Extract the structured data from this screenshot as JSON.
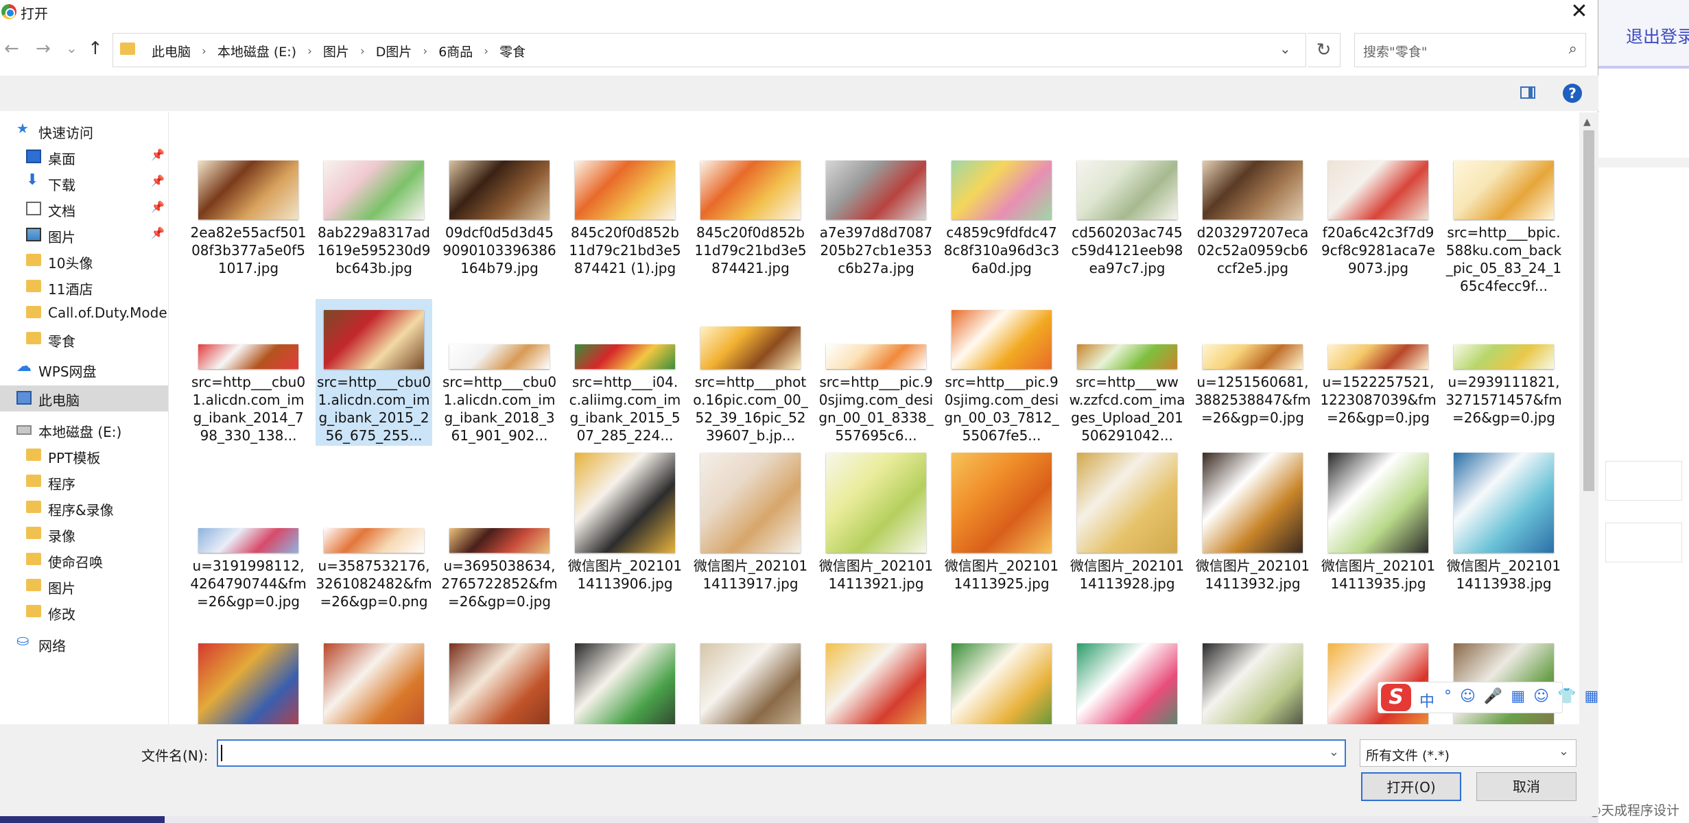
{
  "dialog": {
    "title": "打开",
    "close_glyph": "✕"
  },
  "nav": {
    "back": "←",
    "forward": "→",
    "recent": "⌄",
    "up": "↑",
    "refresh": "↻"
  },
  "breadcrumbs": [
    "此电脑",
    "本地磁盘 (E:)",
    "图片",
    "D图片",
    "6商品",
    "零食"
  ],
  "search": {
    "placeholder": "搜索\"零食\"",
    "icon": "search-icon"
  },
  "toolbar": {
    "help": "?"
  },
  "sidebar": {
    "items": [
      {
        "label": "快速访问",
        "icon": "star-icon",
        "pinned": false,
        "indent": 1
      },
      {
        "label": "桌面",
        "icon": "desktop-icon",
        "pinned": true,
        "indent": 2
      },
      {
        "label": "下载",
        "icon": "download-icon",
        "pinned": true,
        "indent": 2
      },
      {
        "label": "文档",
        "icon": "document-icon",
        "pinned": true,
        "indent": 2
      },
      {
        "label": "图片",
        "icon": "pictures-icon",
        "pinned": true,
        "indent": 2
      },
      {
        "label": "10头像",
        "icon": "folder-icon",
        "pinned": false,
        "indent": 2
      },
      {
        "label": "11酒店",
        "icon": "folder-icon",
        "pinned": false,
        "indent": 2
      },
      {
        "label": "Call.of.Duty.Mode",
        "icon": "folder-icon",
        "pinned": false,
        "indent": 2
      },
      {
        "label": "零食",
        "icon": "folder-icon",
        "pinned": false,
        "indent": 2
      },
      {
        "label": "WPS网盘",
        "icon": "cloud-icon",
        "pinned": false,
        "indent": 1
      },
      {
        "label": "此电脑",
        "icon": "computer-icon",
        "pinned": false,
        "indent": 1,
        "selected": true
      },
      {
        "label": "本地磁盘 (E:)",
        "icon": "disk-icon",
        "pinned": false,
        "indent": 1
      },
      {
        "label": "PPT模板",
        "icon": "folder-icon",
        "pinned": false,
        "indent": 2
      },
      {
        "label": "程序",
        "icon": "folder-icon",
        "pinned": false,
        "indent": 2
      },
      {
        "label": "程序&录像",
        "icon": "folder-icon",
        "pinned": false,
        "indent": 2
      },
      {
        "label": "录像",
        "icon": "folder-icon",
        "pinned": false,
        "indent": 2
      },
      {
        "label": "使命召唤",
        "icon": "folder-icon",
        "pinned": false,
        "indent": 2
      },
      {
        "label": "图片",
        "icon": "folder-icon",
        "pinned": false,
        "indent": 2
      },
      {
        "label": "修改",
        "icon": "folder-icon",
        "pinned": false,
        "indent": 2
      },
      {
        "label": "网络",
        "icon": "network-icon",
        "pinned": false,
        "indent": 1
      }
    ]
  },
  "files": [
    {
      "name": "2ea82e55acf50108f3b377a5e0f51017.jpg",
      "colors": [
        "#7a3b1c",
        "#d9a35e",
        "#f1e3c8"
      ],
      "aspect": "wide"
    },
    {
      "name": "8ab229a8317ad1619e595230d9bc643b.jpg",
      "colors": [
        "#f0c9d0",
        "#7cc26a",
        "#f7f3ef"
      ],
      "aspect": "wide"
    },
    {
      "name": "09dcf0d5d3d459090103396386164b79.jpg",
      "colors": [
        "#3a2214",
        "#8b5a32",
        "#d9c2a0"
      ],
      "aspect": "wide"
    },
    {
      "name": "845c20f0d852b11d79c21bd3e5874421 (1).jpg",
      "colors": [
        "#e86a2a",
        "#f2c14e",
        "#fbf3e8"
      ],
      "aspect": "wide"
    },
    {
      "name": "845c20f0d852b11d79c21bd3e5874421.jpg",
      "colors": [
        "#e86a2a",
        "#f2c14e",
        "#fbf3e8"
      ],
      "aspect": "wide"
    },
    {
      "name": "a7e397d8d7087205b27cb1e353c6b27a.jpg",
      "colors": [
        "#9a9a9a",
        "#b8433f",
        "#d6d6d6"
      ],
      "aspect": "wide"
    },
    {
      "name": "c4859c9fdfdc478c8f310a96d3c36a0d.jpg",
      "colors": [
        "#f4d65a",
        "#e78fb3",
        "#9fd6a6"
      ],
      "aspect": "wide"
    },
    {
      "name": "cd560203ac745c59d4121eeb98ea97c7.jpg",
      "colors": [
        "#dfe6d2",
        "#a6b98f",
        "#f6f4ee"
      ],
      "aspect": "wide"
    },
    {
      "name": "d203297207eca02c52a0959cb6ccf2e5.jpg",
      "colors": [
        "#5a3a24",
        "#a57a52",
        "#e2cfb4"
      ],
      "aspect": "wide"
    },
    {
      "name": "f20a6c42c3f7d99cf8c9281aca7e9073.jpg",
      "colors": [
        "#f5f1ec",
        "#d8453a",
        "#efe3d6"
      ],
      "aspect": "wide"
    },
    {
      "name": "src=http___bpic.588ku.com_back_pic_05_83_24_165c4fecc9f...",
      "colors": [
        "#f7e6b6",
        "#e6a53a",
        "#fff6da"
      ],
      "aspect": "wide"
    },
    {
      "name": "src=http___cbu01.alicdn.com_img_ibank_2014_798_330_138...",
      "colors": [
        "#f6f6f6",
        "#b3541e",
        "#e33d3d"
      ],
      "aspect": "banner"
    },
    {
      "name": "src=http___cbu01.alicdn.com_img_ibank_2015_256_675_255...",
      "colors": [
        "#c3272b",
        "#f2d9a5",
        "#7a4b2a"
      ],
      "aspect": "wide",
      "selected": true
    },
    {
      "name": "src=http___cbu01.alicdn.com_img_ibank_2018_361_901_902...",
      "colors": [
        "#f1f1f1",
        "#d89b55",
        "#ffffff"
      ],
      "aspect": "banner"
    },
    {
      "name": "src=http___i04.c.aliimg.com_img_ibank_2015_507_285_224...",
      "colors": [
        "#d6272a",
        "#f3c743",
        "#3a8e3a"
      ],
      "aspect": "banner"
    },
    {
      "name": "src=http___photo.16pic.com_00_52_39_16pic_5239607_b.jp...",
      "colors": [
        "#f2b233",
        "#8c4c1f",
        "#fff1c7"
      ],
      "aspect": "mid"
    },
    {
      "name": "src=http___pic.90sjimg.com_design_00_01_8338_557695c6...",
      "colors": [
        "#fbe2b8",
        "#f08a3c",
        "#ffffff"
      ],
      "aspect": "banner"
    },
    {
      "name": "src=http___pic.90sjimg.com_design_00_03_7812_55067fe5...",
      "colors": [
        "#fffaf0",
        "#f2a922",
        "#e86b2a"
      ],
      "aspect": "wide"
    },
    {
      "name": "src=http___www.zzfcd.com_images_Upload_201506291042...",
      "colors": [
        "#e7f3d6",
        "#7fbf3f",
        "#c9842c"
      ],
      "aspect": "banner"
    },
    {
      "name": "u=1251560681,3882538847&fm=26&gp=0.jpg",
      "colors": [
        "#f7d37a",
        "#c1702a",
        "#fff4d1"
      ],
      "aspect": "banner"
    },
    {
      "name": "u=1522257521,1223087039&fm=26&gp=0.jpg",
      "colors": [
        "#f5c96a",
        "#b7472a",
        "#fff3d1"
      ],
      "aspect": "banner"
    },
    {
      "name": "u=2939111821,3271571457&fm=26&gp=0.jpg",
      "colors": [
        "#b7d66a",
        "#e9c84a",
        "#f6f9e8"
      ],
      "aspect": "banner"
    },
    {
      "name": "u=3191998112,4264790744&fm=26&gp=0.jpg",
      "colors": [
        "#e8edf7",
        "#d84a6a",
        "#8fb3e0"
      ],
      "aspect": "banner"
    },
    {
      "name": "u=3587532176,3261082482&fm=26&gp=0.png",
      "colors": [
        "#e3763a",
        "#f6d9b5",
        "#ffffff"
      ],
      "aspect": "banner"
    },
    {
      "name": "u=3695038634,2765722852&fm=26&gp=0.jpg",
      "colors": [
        "#4a1f1a",
        "#c74b3a",
        "#eac17a"
      ],
      "aspect": "banner"
    },
    {
      "name": "微信图片_20210114113906.jpg",
      "colors": [
        "#f6f1ea",
        "#2d2d2d",
        "#e7b23c"
      ],
      "aspect": "square"
    },
    {
      "name": "微信图片_20210114113917.jpg",
      "colors": [
        "#e9d9c8",
        "#d7a66a",
        "#f4efe8"
      ],
      "aspect": "square"
    },
    {
      "name": "微信图片_20210114113921.jpg",
      "colors": [
        "#e9ec9a",
        "#b5cf5e",
        "#f7f7ea"
      ],
      "aspect": "square"
    },
    {
      "name": "微信图片_20210114113925.jpg",
      "colors": [
        "#f08e2a",
        "#d95f1a",
        "#f7c25a"
      ],
      "aspect": "square"
    },
    {
      "name": "微信图片_20210114113928.jpg",
      "colors": [
        "#f5f0e6",
        "#e6c26a",
        "#d2a94c"
      ],
      "aspect": "square"
    },
    {
      "name": "微信图片_20210114113932.jpg",
      "colors": [
        "#ffffff",
        "#c9852a",
        "#3a2a20"
      ],
      "aspect": "square"
    },
    {
      "name": "微信图片_20210114113935.jpg",
      "colors": [
        "#ffffff",
        "#b9d98a",
        "#2b2b2b"
      ],
      "aspect": "square"
    },
    {
      "name": "微信图片_20210114113938.jpg",
      "colors": [
        "#f6f9fb",
        "#6cc3d8",
        "#2a6fa8"
      ],
      "aspect": "square"
    },
    {
      "name": "",
      "colors": [
        "#e3aa3a",
        "#3a5fae",
        "#d6392f"
      ],
      "aspect": "square"
    },
    {
      "name": "",
      "colors": [
        "#f7f2ec",
        "#d9792a",
        "#b9472a"
      ],
      "aspect": "square"
    },
    {
      "name": "",
      "colors": [
        "#f3e6d6",
        "#c1542a",
        "#7a2f1a"
      ],
      "aspect": "square"
    },
    {
      "name": "",
      "colors": [
        "#f5f1ea",
        "#4aa24a",
        "#2a2a2a"
      ],
      "aspect": "square"
    },
    {
      "name": "",
      "colors": [
        "#f6f3ee",
        "#8a6a48",
        "#d6c6a8"
      ],
      "aspect": "square"
    },
    {
      "name": "",
      "colors": [
        "#f6f3ee",
        "#d53d2f",
        "#f2c14e"
      ],
      "aspect": "square"
    },
    {
      "name": "",
      "colors": [
        "#fdf6ea",
        "#e9b23c",
        "#3a8e3a"
      ],
      "aspect": "square"
    },
    {
      "name": "",
      "colors": [
        "#ffffff",
        "#e84d7a",
        "#2c9c6a"
      ],
      "aspect": "square"
    },
    {
      "name": "",
      "colors": [
        "#f5f3ee",
        "#b9c98a",
        "#2b2b2b"
      ],
      "aspect": "square"
    },
    {
      "name": "",
      "colors": [
        "#fff5f0",
        "#d9342a",
        "#f2b23c"
      ],
      "aspect": "square"
    },
    {
      "name": "",
      "colors": [
        "#ece9e2",
        "#6aa04a",
        "#8a6a48"
      ],
      "aspect": "square"
    }
  ],
  "bottom": {
    "filename_label": "文件名(N):",
    "filename_value": "",
    "filter_value": "所有文件 (*.*)",
    "open_button": "打开(O)",
    "cancel_button": "取消"
  },
  "ime": {
    "zh": "中",
    "s": "S"
  },
  "background_app": {
    "logout": "退出登录"
  },
  "watermark": "CSDN @天成程序设计"
}
